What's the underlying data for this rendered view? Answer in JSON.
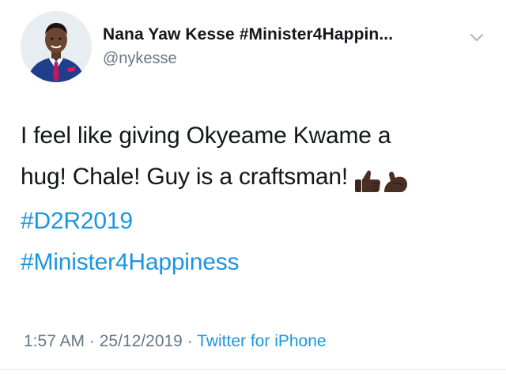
{
  "tweet": {
    "display_name": "Nana Yaw Kesse #Minister4Happin...",
    "handle": "@nykesse",
    "text_line1": "I feel like giving Okyeame Kwame a",
    "text_line2": "hug! Chale! Guy is a craftsman!",
    "hashtags": [
      "#D2R2019",
      "#Minister4Happiness"
    ],
    "emojis": [
      "thumbs-up-dark-skin",
      "flexed-biceps-dark-skin"
    ],
    "time": "1:57 AM",
    "date": "25/12/2019",
    "separator": "·",
    "source": "Twitter for iPhone"
  },
  "colors": {
    "text": "#14171a",
    "secondary": "#657786",
    "link": "#1b95e0"
  },
  "icons": {
    "caret": "chevron-down-icon",
    "avatar": "profile-photo"
  }
}
